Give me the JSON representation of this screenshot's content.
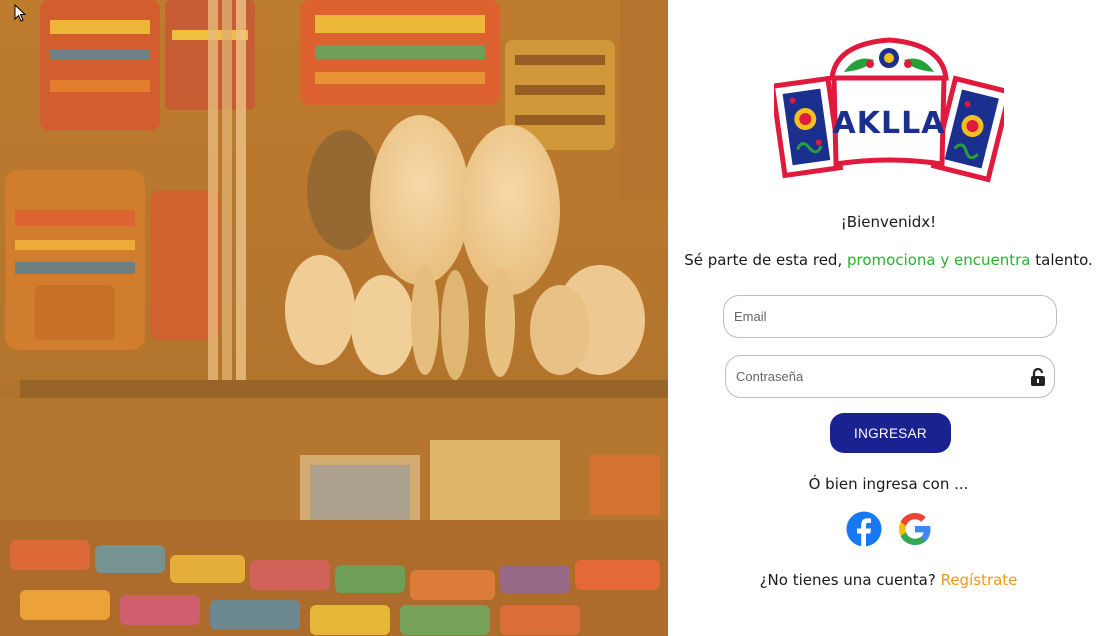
{
  "brand": {
    "logo_text": "AKLLA"
  },
  "hero": {
    "alt": "Market stall with alpaca plushies and textiles"
  },
  "login": {
    "welcome": "¡Bienvenidx!",
    "tagline_prefix": "Sé parte de esta red, ",
    "tagline_highlight": "promociona y encuentra",
    "tagline_suffix": " talento.",
    "email_placeholder": "Email",
    "password_placeholder": "Contraseña",
    "submit_label": "INGRESAR",
    "alt_login_text": "Ó bien ingresa con ...",
    "signup_prompt": "¿No tienes una cuenta? ",
    "signup_link": "Regístrate"
  },
  "social": [
    {
      "name": "facebook",
      "icon": "facebook-icon"
    },
    {
      "name": "google",
      "icon": "google-icon"
    }
  ],
  "colors": {
    "primary_button": "#1a2191",
    "highlight_green": "#2bb12b",
    "signup_orange": "#f0961a",
    "hero_tint": "#e8a23a"
  }
}
